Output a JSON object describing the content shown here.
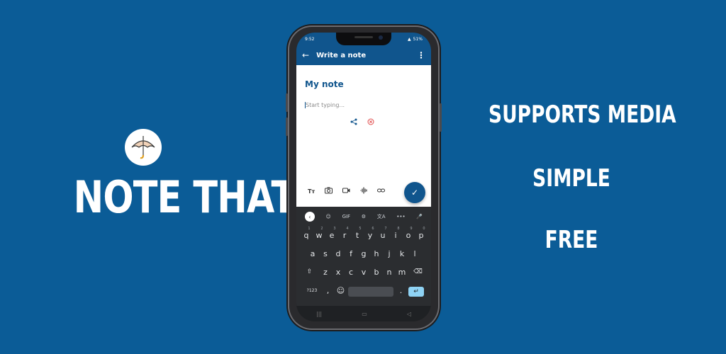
{
  "brand": {
    "title": "NOTE THAT",
    "logo_icon": "umbrella-icon"
  },
  "features": [
    "SUPPORTS MEDIA",
    "SIMPLE",
    "FREE"
  ],
  "colors": {
    "background": "#0b5c97",
    "accent": "#10558d",
    "remove": "#e14c4c"
  },
  "phone": {
    "status": {
      "time": "9:52",
      "battery": "51%"
    },
    "appbar": {
      "back": "←",
      "title": "Write a note",
      "more": "⋮"
    },
    "note": {
      "title": "My note",
      "placeholder": "Start typing..."
    },
    "toolbar": {
      "text_format": "Tт",
      "camera": "📷",
      "video": "🎥",
      "audio": "🎙",
      "link": "🔗",
      "save": "✓"
    },
    "keyboard": {
      "top": [
        "‹",
        "☺",
        "GIF",
        "⚙",
        "文A",
        "•••",
        "🎤"
      ],
      "row1": [
        "q",
        "w",
        "e",
        "r",
        "t",
        "y",
        "u",
        "i",
        "o",
        "p"
      ],
      "row1_nums": [
        "1",
        "2",
        "3",
        "4",
        "5",
        "6",
        "7",
        "8",
        "9",
        "0"
      ],
      "row2": [
        "a",
        "s",
        "d",
        "f",
        "g",
        "h",
        "j",
        "k",
        "l"
      ],
      "row3": [
        "⇧",
        "z",
        "x",
        "c",
        "v",
        "b",
        "n",
        "m",
        "⌫"
      ],
      "row4": {
        "numbers": "?123",
        "comma": ",",
        "emoji": "☺",
        "period": ".",
        "enter": "↵"
      }
    }
  }
}
